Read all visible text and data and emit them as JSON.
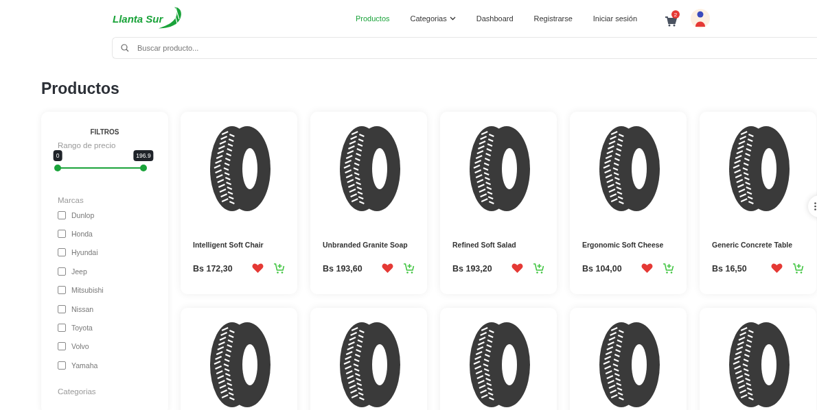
{
  "header": {
    "logo": "Llanta Sur",
    "nav": [
      {
        "label": "Productos",
        "selected": true,
        "kind": "link"
      },
      {
        "label": "Categorias",
        "selected": false,
        "kind": "dropdown"
      },
      {
        "label": "Dashboard",
        "selected": false,
        "kind": "link"
      },
      {
        "label": "Registrarse",
        "selected": false,
        "kind": "link"
      },
      {
        "label": "Iniciar sesión",
        "selected": false,
        "kind": "link"
      }
    ],
    "cart_count": "2"
  },
  "search": {
    "placeholder": "Buscar producto..."
  },
  "page_title": "Productos",
  "filters": {
    "title": "FILTROS",
    "price_label": "Rango de precio",
    "price_range": {
      "min_label": "0",
      "max_label": "196.9",
      "low": {
        "level": 0
      },
      "high": {
        "level": 1
      }
    },
    "brands_label": "Marcas",
    "brands": [
      {
        "label": "Dunlop",
        "checked": false
      },
      {
        "label": "Honda",
        "checked": false
      },
      {
        "label": "Hyundai",
        "checked": false
      },
      {
        "label": "Jeep",
        "checked": false
      },
      {
        "label": "Mitsubishi",
        "checked": false
      },
      {
        "label": "Nissan",
        "checked": false
      },
      {
        "label": "Toyota",
        "checked": false
      },
      {
        "label": "Volvo",
        "checked": false
      },
      {
        "label": "Yamaha",
        "checked": false
      }
    ],
    "categories_label": "Categorias"
  },
  "products": [
    {
      "kind": "full",
      "name": "Intelligent Soft Chair",
      "price": "Bs 172,30"
    },
    {
      "kind": "full",
      "name": "Unbranded Granite Soap",
      "price": "Bs 193,60"
    },
    {
      "kind": "full",
      "name": "Refined Soft Salad",
      "price": "Bs 193,20"
    },
    {
      "kind": "full",
      "name": "Ergonomic Soft Cheese",
      "price": "Bs 104,00"
    },
    {
      "kind": "full",
      "name": "Generic Concrete Table",
      "price": "Bs 16,50"
    },
    {
      "kind": "image"
    },
    {
      "kind": "image"
    },
    {
      "kind": "image"
    },
    {
      "kind": "image"
    },
    {
      "kind": "image"
    }
  ]
}
